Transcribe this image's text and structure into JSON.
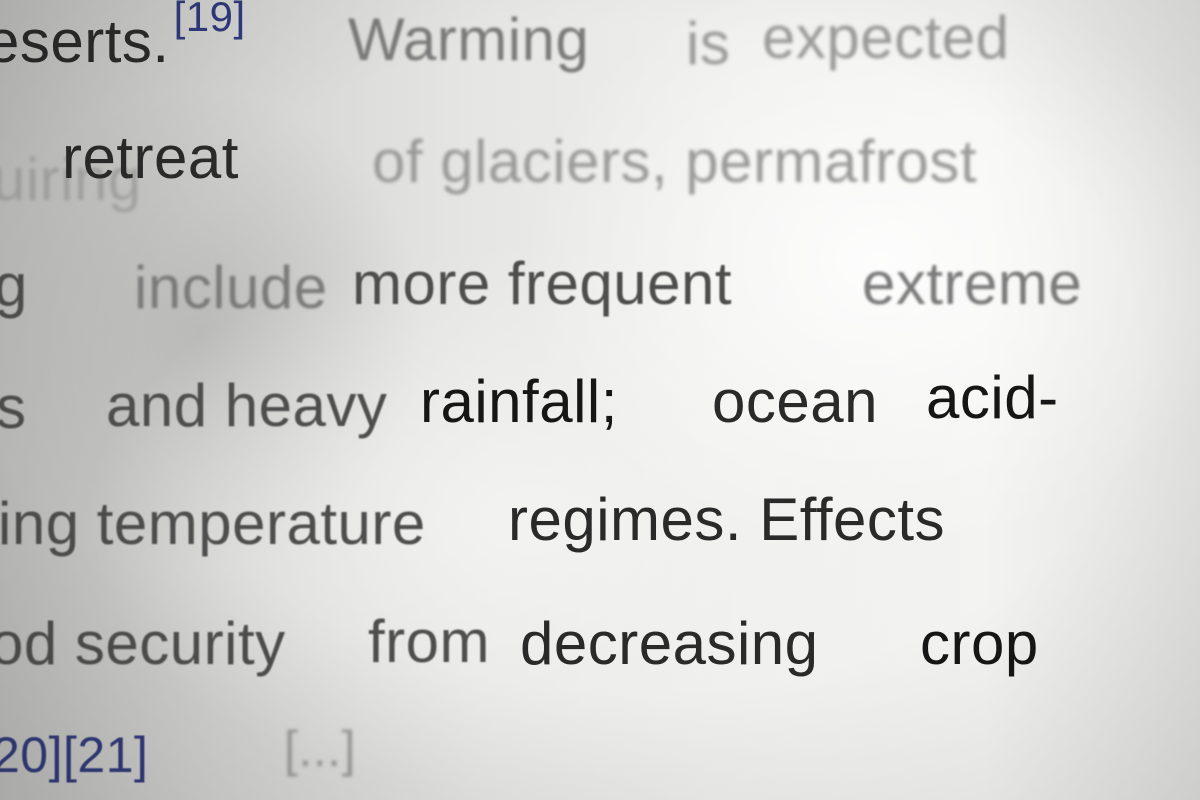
{
  "lines": [
    {
      "words": [
        {
          "text": "eserts.",
          "sup": "[19]"
        },
        {
          "text": "Warming"
        },
        {
          "text": "is"
        },
        {
          "text": "expected"
        }
      ]
    },
    {
      "words": [
        {
          "text": "retreat"
        },
        {
          "text": "of glaciers, permafrost"
        }
      ],
      "ghost": "uiring"
    },
    {
      "words": [
        {
          "text": "g"
        },
        {
          "text": "include"
        },
        {
          "text": "more frequent"
        },
        {
          "text": "extreme"
        }
      ]
    },
    {
      "words": [
        {
          "text": "s"
        },
        {
          "text": "and heavy"
        },
        {
          "text": "rainfall;"
        },
        {
          "text": "ocean"
        },
        {
          "text": "acid-"
        }
      ]
    },
    {
      "words": [
        {
          "text": "ing temperature"
        },
        {
          "text": "regimes. Effects"
        }
      ]
    },
    {
      "words": [
        {
          "text": "od security"
        },
        {
          "text": "from"
        },
        {
          "text": "decreasing"
        },
        {
          "text": "crop"
        }
      ]
    },
    {
      "words": [
        {
          "text": "20][21]"
        },
        {
          "text": "[...]"
        }
      ]
    }
  ],
  "colors": {
    "text": "#161616",
    "link": "#303a78",
    "paper": "#efefed"
  }
}
